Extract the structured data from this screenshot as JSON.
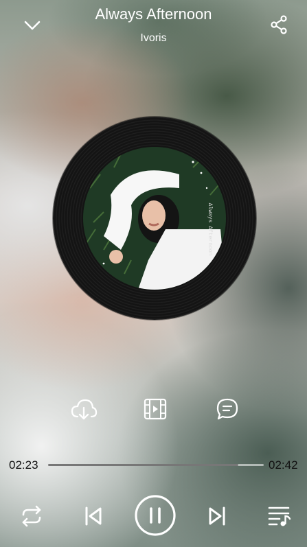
{
  "track": {
    "title": "Always Afternoon",
    "artist": "Ivoris",
    "cover_text": "Always Afternoon"
  },
  "header": {
    "collapse_icon": "chevron-down-icon",
    "share_icon": "share-icon"
  },
  "actions": {
    "download_icon": "cloud-download-icon",
    "video_icon": "film-icon",
    "comment_icon": "comment-icon"
  },
  "playback": {
    "elapsed": "02:23",
    "duration": "02:42",
    "progress": 0.883
  },
  "controls": {
    "repeat_icon": "repeat-icon",
    "previous_icon": "skip-previous-icon",
    "pause_icon": "pause-icon",
    "next_icon": "skip-next-icon",
    "playlist_icon": "playlist-icon"
  },
  "colors": {
    "text": "#ffffff",
    "time_text": "#111111"
  }
}
